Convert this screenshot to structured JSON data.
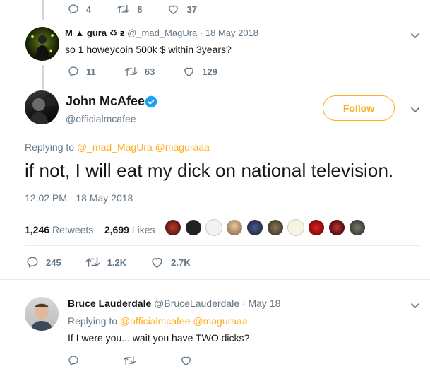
{
  "top_actions": {
    "replies": "4",
    "retweets": "8",
    "likes": "37"
  },
  "reply1": {
    "display_name": "M ▲ gura ♻ ƶ",
    "handle": "@_mad_MagUra",
    "date": "· 18 May 2018",
    "text": "so 1 howeycoin 500k $ within 3years?",
    "replies": "11",
    "retweets": "63",
    "likes": "129"
  },
  "main": {
    "name": "John McAfee",
    "handle": "@officialmcafee",
    "follow_label": "Follow",
    "replying_prefix": "Replying to",
    "replying_to": "@_mad_MagUra @maguraaa",
    "text": "if not, I will eat my dick on national television.",
    "timestamp": "12:02 PM - 18 May 2018",
    "retweets_count": "1,246",
    "retweets_label": "Retweets",
    "likes_count": "2,699",
    "likes_label": "Likes",
    "replies": "245",
    "retweet_action": "1.2K",
    "like_action": "2.7K"
  },
  "reply2": {
    "name": "Bruce Lauderdale",
    "handle": "@BruceLauderdale",
    "date": "· May 18",
    "replying_prefix": "Replying to",
    "replying_to": "@officialmcafee @maguraaa",
    "text": "If I were you... wait you have TWO dicks?"
  },
  "colors": {
    "accent": "#ffad1f",
    "muted": "#657786",
    "verified": "#1da1f2",
    "text": "#14171a"
  },
  "icons": [
    "reply-icon",
    "retweet-icon",
    "like-icon",
    "chevron-down-icon",
    "verified-icon"
  ]
}
